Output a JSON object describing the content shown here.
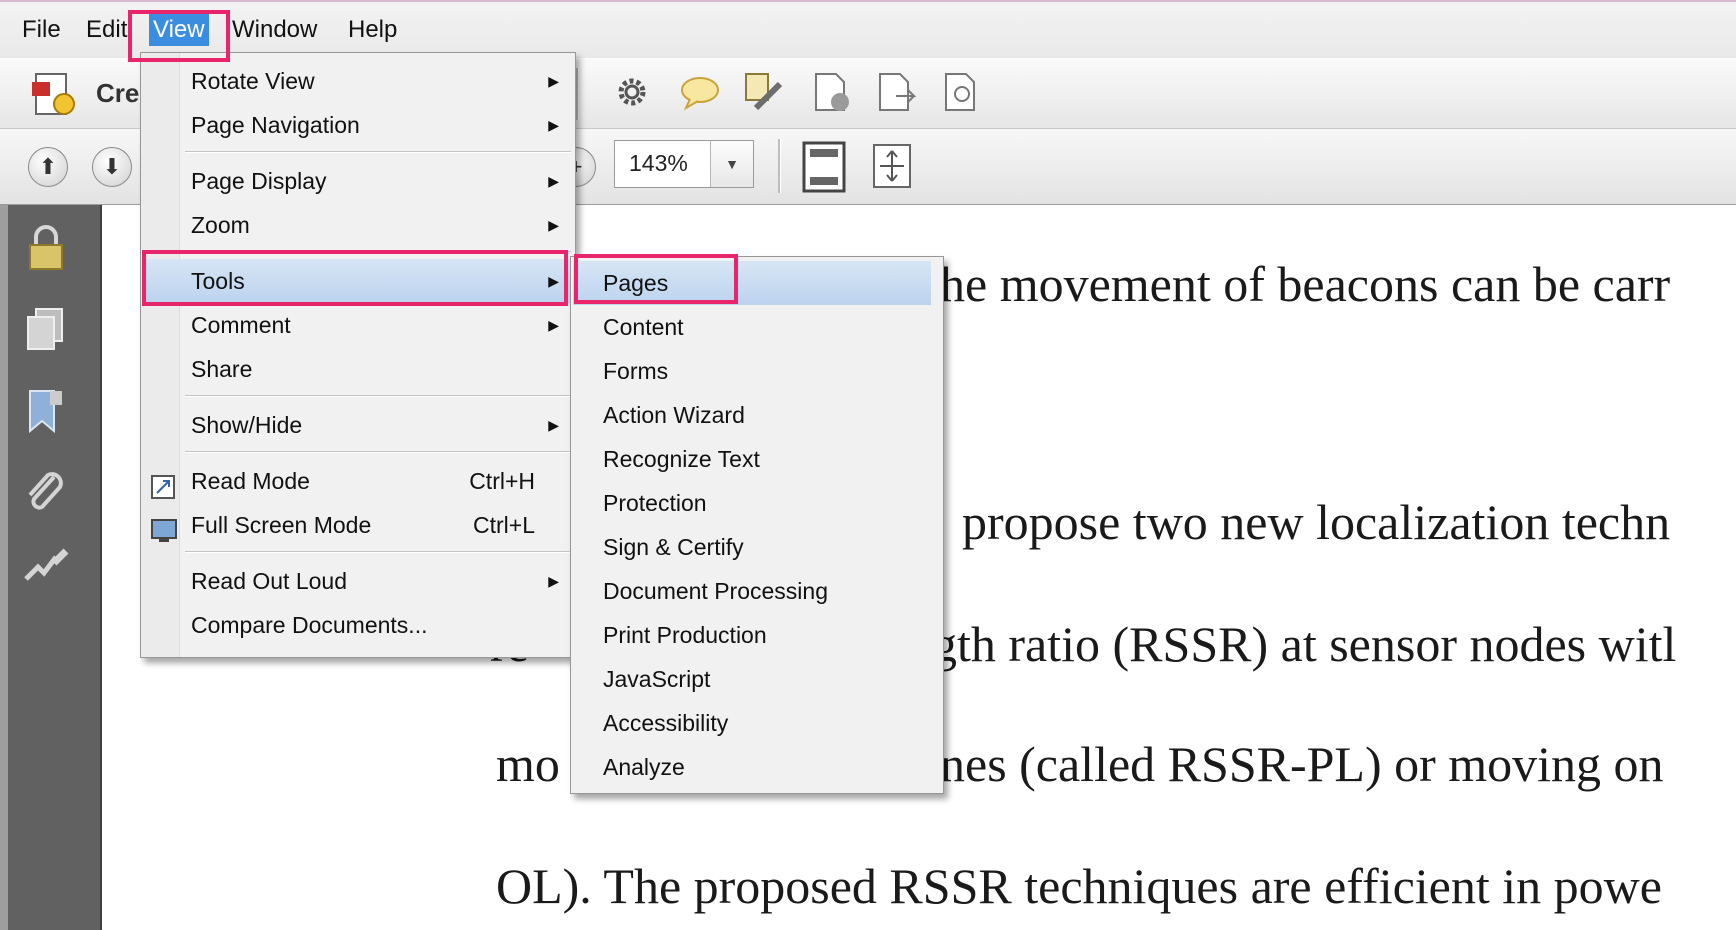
{
  "menubar": {
    "items": [
      "File",
      "Edit",
      "View",
      "Window",
      "Help"
    ],
    "active": "View"
  },
  "toolbar": {
    "create_label": "Crea",
    "zoom_value": "143%"
  },
  "view_menu": {
    "items": [
      {
        "label": "Rotate View",
        "shortcut": "",
        "submenu": true
      },
      {
        "label": "Page Navigation",
        "shortcut": "",
        "submenu": true
      },
      {
        "label": "Page Display",
        "shortcut": "",
        "submenu": true
      },
      {
        "label": "Zoom",
        "shortcut": "",
        "submenu": true
      },
      {
        "label": "Tools",
        "shortcut": "",
        "submenu": true
      },
      {
        "label": "Comment",
        "shortcut": "",
        "submenu": true
      },
      {
        "label": "Share",
        "shortcut": "",
        "submenu": false
      },
      {
        "label": "Show/Hide",
        "shortcut": "",
        "submenu": true
      },
      {
        "label": "Read Mode",
        "shortcut": "Ctrl+H",
        "submenu": false
      },
      {
        "label": "Full Screen Mode",
        "shortcut": "Ctrl+L",
        "submenu": false
      },
      {
        "label": "Read Out Loud",
        "shortcut": "",
        "submenu": true
      },
      {
        "label": "Compare Documents...",
        "shortcut": "",
        "submenu": false
      }
    ]
  },
  "tools_submenu": {
    "items": [
      "Pages",
      "Content",
      "Forms",
      "Action Wizard",
      "Recognize Text",
      "Protection",
      "Sign & Certify",
      "Document Processing",
      "Print Production",
      "JavaScript",
      "Accessibility",
      "Analyze"
    ]
  },
  "document": {
    "lines": [
      "he movement of beacons can be carr",
      "propose two new localization techn",
      "re",
      "gth ratio (RSSR) at sensor nodes witl",
      "mo",
      "nes (called RSSR-PL) or moving on",
      "OL). The proposed RSSR techniques are efficient in powe"
    ]
  },
  "colors": {
    "highlight_box": "#e8256a",
    "menu_hover": "#bcd3ee",
    "menubar_active": "#3b8ddf",
    "left_pane": "#616161"
  }
}
